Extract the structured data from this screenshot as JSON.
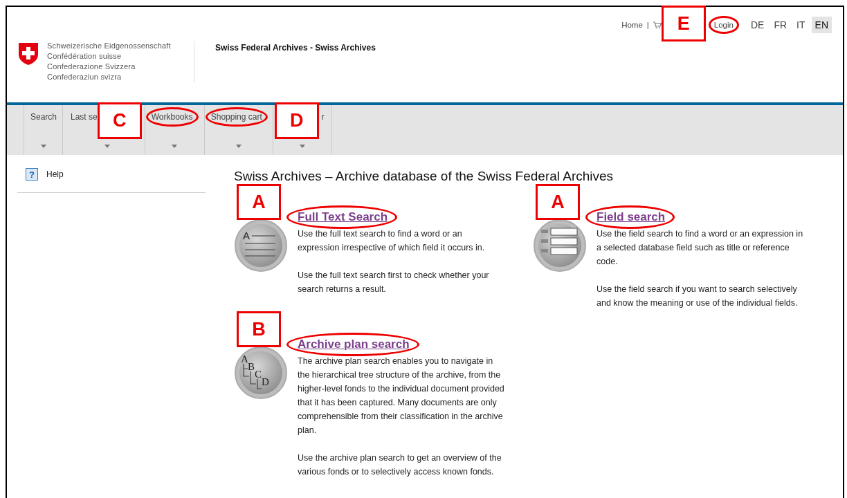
{
  "header": {
    "emblem_lines": [
      "Schweizerische Eidgenossenschaft",
      "Confédération suisse",
      "Confederazione Svizzera",
      "Confederaziun svizra"
    ],
    "site_title": "Swiss Federal Archives - Swiss Archives",
    "top_links": {
      "home": "Home",
      "separator": "|",
      "callout": "E",
      "login": {
        "label": "Login",
        "circled": true
      }
    },
    "languages": [
      {
        "label": "DE",
        "selected": false
      },
      {
        "label": "FR",
        "selected": false
      },
      {
        "label": "IT",
        "selected": false
      },
      {
        "label": "EN",
        "selected": true
      }
    ]
  },
  "nav_tabs": [
    {
      "label": "Search"
    },
    {
      "label": "Last se",
      "callout_after": "C"
    },
    {
      "label": "Workbooks",
      "circled": true
    },
    {
      "label": "Shopping cart",
      "circled": true
    },
    {
      "label": "r",
      "callout_before": "D"
    }
  ],
  "sidebar": {
    "items": [
      {
        "label": "Help",
        "icon_glyph": "?"
      }
    ]
  },
  "main": {
    "heading": "Swiss Archives – Archive database of the Swiss Federal Archives",
    "columns": [
      [
        {
          "kind": "fulltext",
          "title": "Full Text Search",
          "circled": true,
          "callout": "A",
          "icon_letters": [
            "A"
          ],
          "paragraphs": [
            "Use the full text search to find a word or an expression irrespective of which field it occurs in.",
            "Use the full text search first to check whether your search returns a result."
          ]
        },
        {
          "kind": "plan",
          "title": "Archive plan search",
          "circled": true,
          "callout": "B",
          "icon_letters": [
            "A",
            "B",
            "C",
            "D"
          ],
          "paragraphs": [
            "The archive plan search enables you to navigate in the hierarchical tree structure of the archive, from the higher-level fonds to the individual document provided that it has been captured. Many documents are only comprehensible from their classification in the archive plan.",
            "Use the archive plan search to get an overview of the various fonds or to selectively access known fonds."
          ]
        }
      ],
      [
        {
          "kind": "field",
          "title": "Field search",
          "circled": true,
          "callout": "A",
          "paragraphs": [
            "Use the field search to find a word or an expression in a selected database field such as title or reference code.",
            "Use the field search if you want to search selectively and know the meaning or use of the individual fields."
          ]
        }
      ]
    ]
  }
}
